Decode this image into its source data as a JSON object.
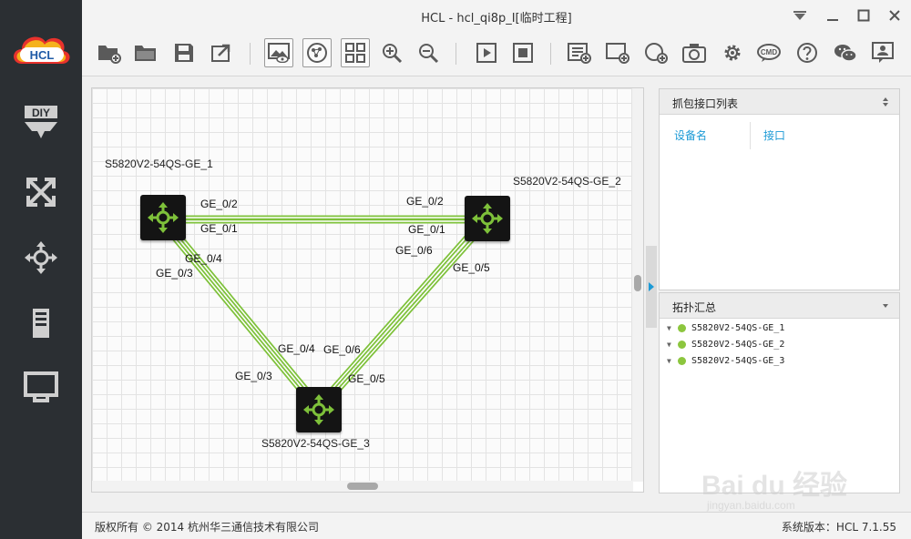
{
  "window": {
    "title": "HCL - hcl_qi8p_I[临时工程]"
  },
  "logo": {
    "text": "HCL"
  },
  "sidebar": {
    "items": [
      {
        "label": "DIY",
        "icon": "diy-icon"
      },
      {
        "label": "",
        "icon": "switch-cross-icon"
      },
      {
        "label": "",
        "icon": "router-move-icon"
      },
      {
        "label": "",
        "icon": "server-icon"
      },
      {
        "label": "",
        "icon": "pc-monitor-icon"
      }
    ]
  },
  "toolbar": {
    "cmd_label": "CMD"
  },
  "topology": {
    "devices": [
      {
        "name": "S5820V2-54QS-GE_1"
      },
      {
        "name": "S5820V2-54QS-GE_2"
      },
      {
        "name": "S5820V2-54QS-GE_3"
      }
    ],
    "ports": {
      "d1_p2": "GE_0/2",
      "d1_p1": "GE_0/1",
      "d1_p4": "GE_0/4",
      "d1_p3": "GE_0/3",
      "d2_p2": "GE_0/2",
      "d2_p1": "GE_0/1",
      "d2_p6": "GE_0/6",
      "d2_p5": "GE_0/5",
      "d3_p4": "GE_0/4",
      "d3_p6": "GE_0/6",
      "d3_p3": "GE_0/3",
      "d3_p5": "GE_0/5"
    },
    "link_color": "#7ec13a"
  },
  "capture_panel": {
    "title": "抓包接口列表",
    "col_device": "设备名",
    "col_interface": "接口"
  },
  "topology_summary": {
    "title": "拓扑汇总",
    "items": [
      "S5820V2-54QS-GE_1",
      "S5820V2-54QS-GE_2",
      "S5820V2-54QS-GE_3"
    ],
    "status_color": "#8cc63e"
  },
  "statusbar": {
    "copyright": "版权所有 © 2014 杭州华三通信技术有限公司",
    "version": "系统版本：HCL 7.1.55"
  },
  "watermark": {
    "text": "Bai du 经验",
    "url": "jingyan.baidu.com"
  }
}
